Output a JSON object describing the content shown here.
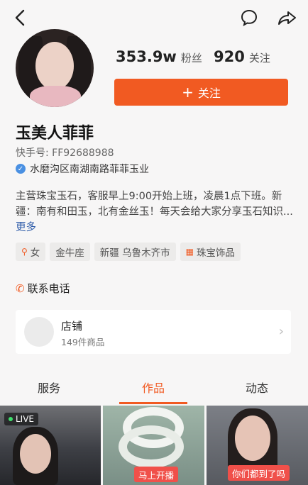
{
  "header": {
    "back_icon": "back-arrow-icon",
    "message_icon": "chat-bubble-icon",
    "share_icon": "share-arrow-icon"
  },
  "profile": {
    "fans_count": "353.9w",
    "fans_label": "粉丝",
    "following_count": "920",
    "following_label": "关注",
    "follow_button_label": "关注",
    "name": "玉美人菲菲",
    "kuaishou_id": "快手号: FF92688988",
    "location": "水磨沟区南湖南路菲菲玉业",
    "bio_text": "主营珠宝玉石，客服早上9:00开始上班，凌晨1点下班。新疆：南有和田玉，北有金丝玉！每天会给大家分享玉石知识...",
    "bio_more": "更多",
    "tags": [
      {
        "icon": "female-icon",
        "label": "女"
      },
      {
        "icon": "",
        "label": "金牛座"
      },
      {
        "icon": "",
        "label": "新疆 乌鲁木齐市"
      },
      {
        "icon": "jewelry-icon",
        "label": "珠宝饰品"
      }
    ],
    "contact_phone_label": "联系电话"
  },
  "shop": {
    "title": "店铺",
    "subtitle": "149件商品"
  },
  "tabs": [
    {
      "label": "服务"
    },
    {
      "label": "作品",
      "active": true
    },
    {
      "label": "动态"
    }
  ],
  "thumbnails": [
    {
      "badge": "LIVE"
    },
    {
      "caption": "马上开播"
    },
    {
      "caption": "你们都到了吗"
    }
  ],
  "colors": {
    "accent": "#f15a22",
    "verified": "#4a90e2"
  }
}
